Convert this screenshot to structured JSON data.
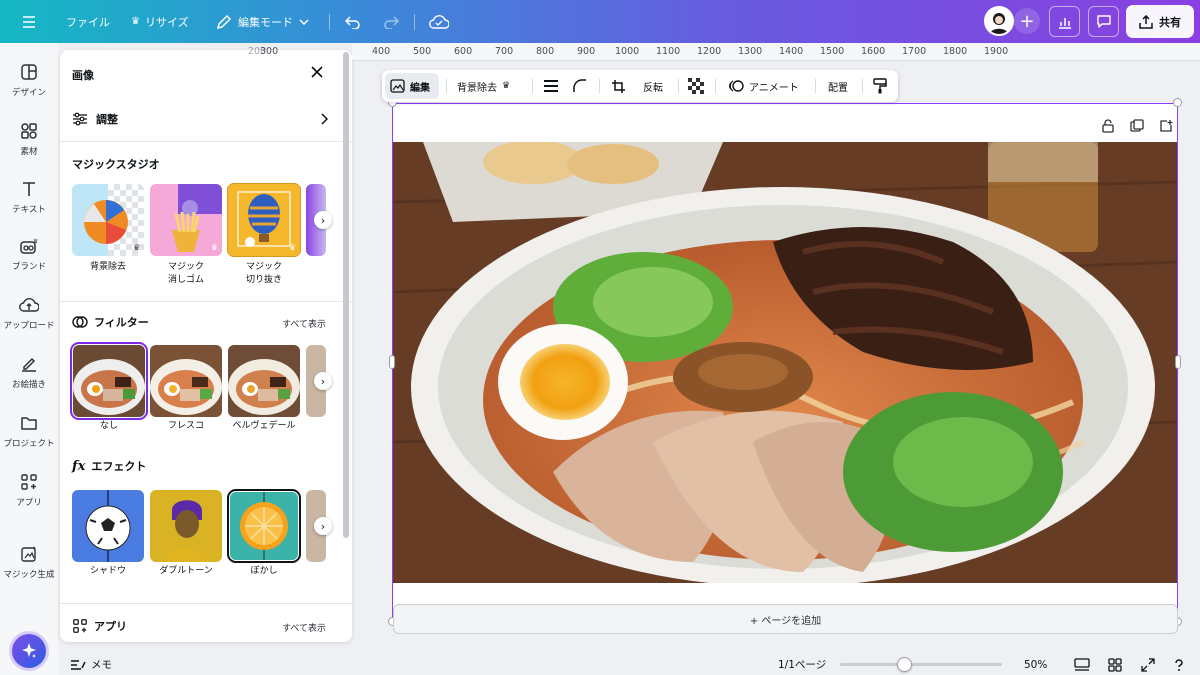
{
  "topbar": {
    "menu_file": "ファイル",
    "resize": "リサイズ",
    "edit_mode": "編集モード",
    "share": "共有"
  },
  "rail": {
    "items": [
      {
        "label": "デザイン",
        "icon": "layout-icon"
      },
      {
        "label": "素材",
        "icon": "shapes-icon"
      },
      {
        "label": "テキスト",
        "icon": "text-icon"
      },
      {
        "label": "ブランド",
        "icon": "brand-icon"
      },
      {
        "label": "アップロード",
        "icon": "upload-icon"
      },
      {
        "label": "お絵描き",
        "icon": "draw-icon"
      },
      {
        "label": "プロジェクト",
        "icon": "folder-icon"
      },
      {
        "label": "アプリ",
        "icon": "apps-icon"
      },
      {
        "label": "マジック生成",
        "icon": "magic-generate-icon"
      }
    ]
  },
  "panel": {
    "title": "画像",
    "adjust": "調整",
    "magic_studio": {
      "title": "マジックスタジオ",
      "items": [
        {
          "label": "背景除去"
        },
        {
          "label": "マジック\n消しゴム"
        },
        {
          "label": "マジック\n切り抜き"
        }
      ]
    },
    "filters": {
      "title": "フィルター",
      "see_all": "すべて表示",
      "items": [
        {
          "label": "なし"
        },
        {
          "label": "フレスコ"
        },
        {
          "label": "ベルヴェデール"
        }
      ]
    },
    "effects": {
      "title": "エフェクト",
      "items": [
        {
          "label": "シャドウ"
        },
        {
          "label": "ダブルトーン"
        },
        {
          "label": "ぼかし"
        }
      ]
    },
    "apps": {
      "title": "アプリ",
      "see_all": "すべて表示"
    }
  },
  "ruler": {
    "ticks": [
      "300",
      "400",
      "500",
      "600",
      "700",
      "800",
      "900",
      "1000",
      "1100",
      "1200",
      "1300",
      "1400",
      "1500",
      "1600",
      "1700",
      "1800",
      "1900"
    ]
  },
  "context_toolbar": {
    "edit": "編集",
    "remove_bg": "背景除去",
    "flip": "反転",
    "animate": "アニメート",
    "position": "配置"
  },
  "canvas": {
    "add_page": "+ ページを追加"
  },
  "bottombar": {
    "notes": "メモ",
    "page_indicator": "1/1ページ",
    "zoom": "50%",
    "zoom_level": 0.4
  },
  "colors": {
    "accent": "#7d2ae8",
    "selection": "#8b3dff"
  }
}
